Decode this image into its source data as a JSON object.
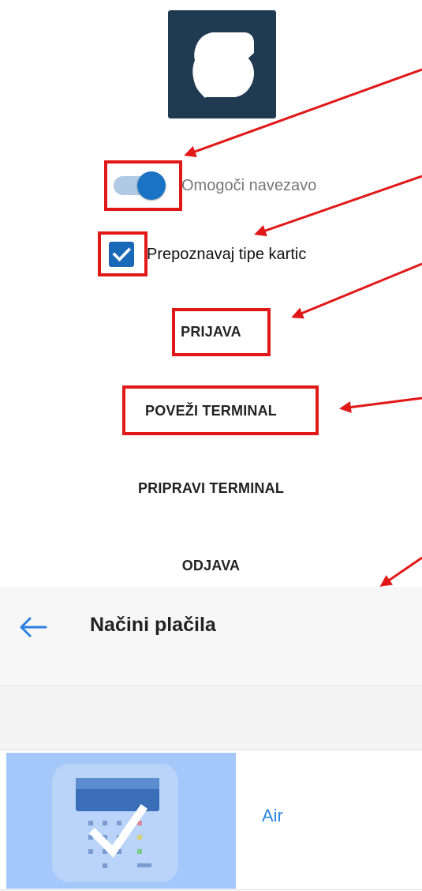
{
  "settings": {
    "toggle_label": "Omogoči navezavo",
    "toggle_on": true,
    "checkbox_label": "Prepoznavaj tipe kartic",
    "checkbox_checked": true,
    "actions": {
      "login": "PRIJAVA",
      "connect_terminal": "POVEŽI TERMINAL",
      "prepare_terminal": "PRIPRAVI TERMINAL",
      "logout": "ODJAVA"
    }
  },
  "appbar": {
    "title": "Načini plačila",
    "back_icon": "arrow-left-icon"
  },
  "payment_methods": [
    {
      "name": "Air",
      "icon": "card-terminal-selected-icon",
      "selected": true
    }
  ],
  "colors": {
    "logo_bg": "#1f3a51",
    "accent": "#1a73c4",
    "highlight": "#e01818",
    "link": "#2a85de",
    "selected_bg": "#a5c8fa"
  }
}
